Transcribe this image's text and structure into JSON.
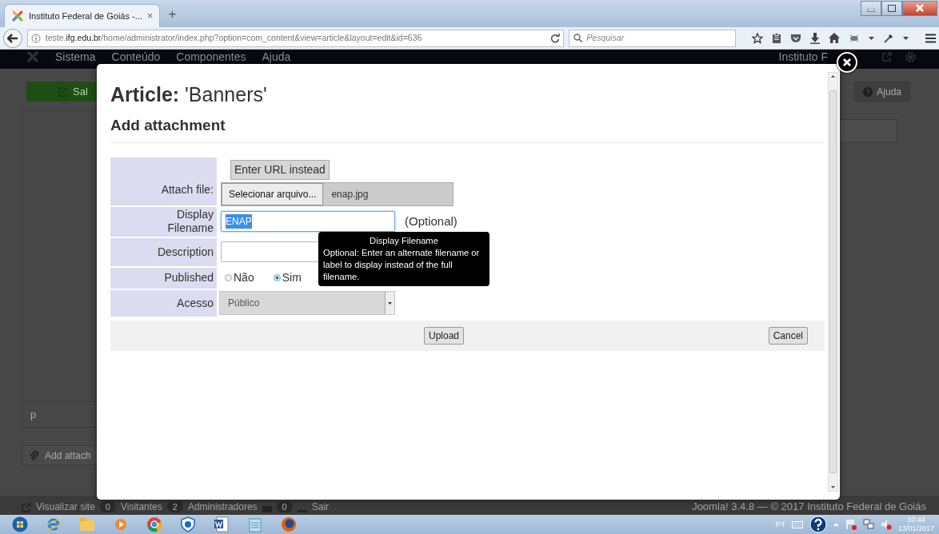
{
  "browser": {
    "tab": {
      "title": "Instituto Federal de Goiás -...",
      "close": "×"
    },
    "new_tab": "+",
    "url": "teste.**ifg.edu.br**/home/administrator/index.php?option=com_content&view=article&layout=edit&id=636",
    "search": {
      "placeholder": "Pesquisar"
    }
  },
  "admin": {
    "menu": [
      "Sistema",
      "Conteúdo",
      "Componentes",
      "Ajuda"
    ],
    "site_name": "Instituto F",
    "save_button": "Sal",
    "help_button": "Ajuda",
    "editor_status": "p",
    "add_attachment_button": "Add attach",
    "footer": {
      "view_site": "Visualizar site",
      "visitors_count": "0",
      "visitors": "Visitantes",
      "admins_count": "2",
      "admins": "Administradores",
      "messages_count": "0",
      "logout": "Sair",
      "credit": "Joomla! 3.4.8 — © 2017 Instituto Federal de Goiás"
    }
  },
  "modal": {
    "title": "**Article:** 'Banners'",
    "subtitle": "Add attachment",
    "fields": [
      {
        "kind": "file",
        "label": "Attach file:",
        "toggle": "Enter URL instead",
        "button": "Selecionar arquivo...",
        "filename": "enap.jpg"
      },
      {
        "kind": "text",
        "label": "Display Filename",
        "value": "ENAP",
        "highlighted": true,
        "focused": true,
        "note": "(Optional)"
      },
      {
        "kind": "text",
        "label": "Description"
      },
      {
        "kind": "radio",
        "label": "Published",
        "options": [
          {
            "label": "Não",
            "selected": false
          },
          {
            "label": "Sim",
            "selected": true
          }
        ]
      },
      {
        "kind": "select",
        "label": "Acesso",
        "value": "Público"
      }
    ],
    "upload_button": "Upload",
    "cancel_button": "Cancel",
    "tooltip": {
      "title": "Display Filename",
      "text": "Optional: Enter an alternate filename or label to display instead of the full filename."
    }
  },
  "taskbar": {
    "language": "PT",
    "time": "10:44",
    "date": "13/01/2017"
  }
}
